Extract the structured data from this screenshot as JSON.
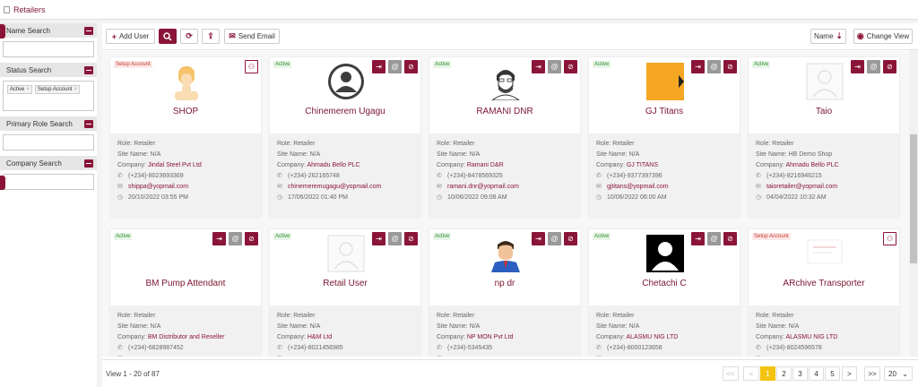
{
  "page": {
    "title": "Retailers"
  },
  "sidebar": {
    "name_search": "Name Search",
    "status_search": "Status Search",
    "status_tags": [
      "Active",
      "Setup Account"
    ],
    "primary_role_search": "Primary Role Search",
    "company_search": "Company Search"
  },
  "toolbar": {
    "add_user": "Add User",
    "send_email": "Send Email",
    "sort_label": "Name",
    "change_view": "Change View"
  },
  "cards": [
    {
      "status": "Setup Account",
      "name": "SHOP",
      "role": "Role: Retailer",
      "site": "Site Name: N/A",
      "company_label": "Company: ",
      "company": "Jindal Steel Pvt Ltd",
      "phone": "(+234)-8023693369",
      "email": "shippa@yopmail.com",
      "date": "20/10/2022 03:55 PM"
    },
    {
      "status": "Active",
      "name": "Chinemerem Ugagu",
      "role": "Role: Retailer",
      "site": "Site Name: N/A",
      "company_label": "Company: ",
      "company": "Ahmadu Bello PLC",
      "phone": "(+234)-262165748",
      "email": "chinemeremugagu@yopmail.com",
      "date": "17/06/2022 01:40 PM"
    },
    {
      "status": "Active",
      "name": "RAMANI DNR",
      "role": "Role: Retailer",
      "site": "Site Name: N/A",
      "company_label": "Company: ",
      "company": "Ramani D&R",
      "phone": "(+234)-8478569325",
      "email": "ramani.dnr@yopmail.com",
      "date": "10/06/2022 09:08 AM"
    },
    {
      "status": "Active",
      "name": "GJ Titans",
      "role": "Role: Retailer",
      "site": "Site Name: N/A",
      "company_label": "Company: ",
      "company": "GJ TITANS",
      "phone": "(+234)-9377397396",
      "email": "gjtitans@yopmail.com",
      "date": "10/06/2022 06:00 AM"
    },
    {
      "status": "Active",
      "name": "Taio",
      "role": "Role: Retailer",
      "site": "Site Name: HB Demo Shop",
      "company_label": "Company: ",
      "company": "Ahmadu Bello PLC",
      "phone": "(+234)-8216946215",
      "email": "taioretailer@yopmail.com",
      "date": "04/04/2022 10:32 AM"
    },
    {
      "status": "Active",
      "name": "BM Pump Attendant",
      "role": "Role: Retailer",
      "site": "Site Name: N/A",
      "company_label": "Company: ",
      "company": "BM Distributor and Reseller",
      "phone": "(+234)-6828987452",
      "email": "",
      "date": ""
    },
    {
      "status": "Active",
      "name": "Retail User",
      "role": "Role: Retailer",
      "site": "Site Name: N/A",
      "company_label": "Company: ",
      "company": "H&M Ltd",
      "phone": "(+234)-8021456985",
      "email": "",
      "date": ""
    },
    {
      "status": "Active",
      "name": "np dr",
      "role": "Role: Retailer",
      "site": "Site Name: N/A",
      "company_label": "Company: ",
      "company": "NP MON Pvt Ltd",
      "phone": "(+234)-5345435",
      "email": "",
      "date": ""
    },
    {
      "status": "Active",
      "name": "Chetachi C",
      "role": "Role: Retailer",
      "site": "Site Name: N/A",
      "company_label": "Company: ",
      "company": "ALASMU NIG LTD",
      "phone": "(+234)-8000123658",
      "email": "",
      "date": ""
    },
    {
      "status": "Setup Account",
      "name": "ARchive Transporter",
      "role": "Role: Retailer",
      "site": "Site Name: N/A",
      "company_label": "Company: ",
      "company": "ALASMU NIG LTD",
      "phone": "(+234)-8024596578",
      "email": "",
      "date": ""
    }
  ],
  "footer": {
    "view_text": "View 1 - 20 of 87",
    "first": "<<",
    "prev": "<",
    "pages": [
      "1",
      "2",
      "3",
      "4",
      "5"
    ],
    "next": ">",
    "last": ">>",
    "page_size": "20"
  },
  "colors": {
    "brand": "#8a1538",
    "current_page": "#f3c30f",
    "active_badge": "#2e8b2e",
    "setup_badge": "#c0392b"
  }
}
